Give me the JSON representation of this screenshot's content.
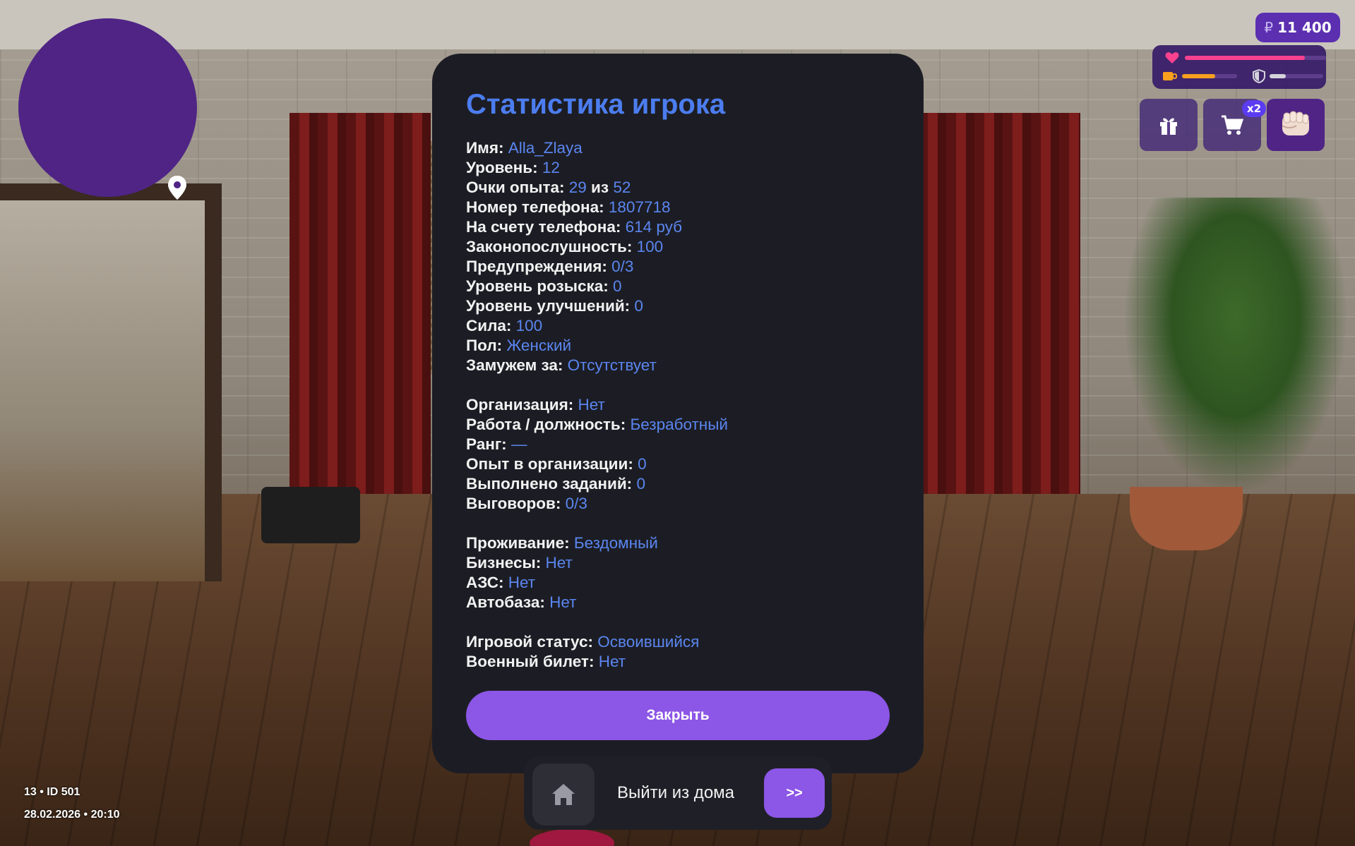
{
  "hud": {
    "money_symbol": "₽",
    "money": "11 400",
    "health_fraction": 0.85,
    "hunger_fraction": 0.6,
    "armor_fraction": 0.3,
    "cart_badge": "x2"
  },
  "modal": {
    "title": "Статистика игрока",
    "groups": [
      [
        {
          "k": "Имя:",
          "v": "Alla_Zlaya"
        },
        {
          "k": "Уровень:",
          "v": "12"
        },
        {
          "k": "Очки опыта:",
          "v": "29",
          "mid": "из",
          "v2": "52"
        },
        {
          "k": "Номер телефона:",
          "v": "1807718"
        },
        {
          "k": "На счету телефона:",
          "v": "614 руб"
        },
        {
          "k": "Законопослушность:",
          "v": "100"
        },
        {
          "k": "Предупреждения:",
          "v": "0/3"
        },
        {
          "k": "Уровень розыска:",
          "v": "0"
        },
        {
          "k": "Уровень улучшений:",
          "v": "0"
        },
        {
          "k": "Сила:",
          "v": "100"
        },
        {
          "k": "Пол:",
          "v": "Женский"
        },
        {
          "k": "Замужем за:",
          "v": "Отсутствует"
        }
      ],
      [
        {
          "k": "Организация:",
          "v": "Нет"
        },
        {
          "k": "Работа / должность:",
          "v": "Безработный"
        },
        {
          "k": "Ранг:",
          "v": "—"
        },
        {
          "k": "Опыт в организации:",
          "v": "0"
        },
        {
          "k": "Выполнено заданий:",
          "v": "0"
        },
        {
          "k": "Выговоров:",
          "v": "0/3"
        }
      ],
      [
        {
          "k": "Проживание:",
          "v": "Бездомный"
        },
        {
          "k": "Бизнесы:",
          "v": "Нет"
        },
        {
          "k": "АЗС:",
          "v": "Нет"
        },
        {
          "k": "Автобаза:",
          "v": "Нет"
        }
      ],
      [
        {
          "k": "Игровой статус:",
          "v": "Освоившийся"
        },
        {
          "k": "Военный билет:",
          "v": "Нет"
        }
      ]
    ],
    "close_label": "Закрыть"
  },
  "exit": {
    "label": "Выйти из дома",
    "go_label": ">>"
  },
  "info": {
    "server_line": "13 • ID 501",
    "datetime": "28.02.2026 • 20:10"
  },
  "colors": {
    "accent": "#8c56e6",
    "value": "#5b86f0",
    "title": "#4c7df0",
    "minimap": "#4f2485"
  }
}
